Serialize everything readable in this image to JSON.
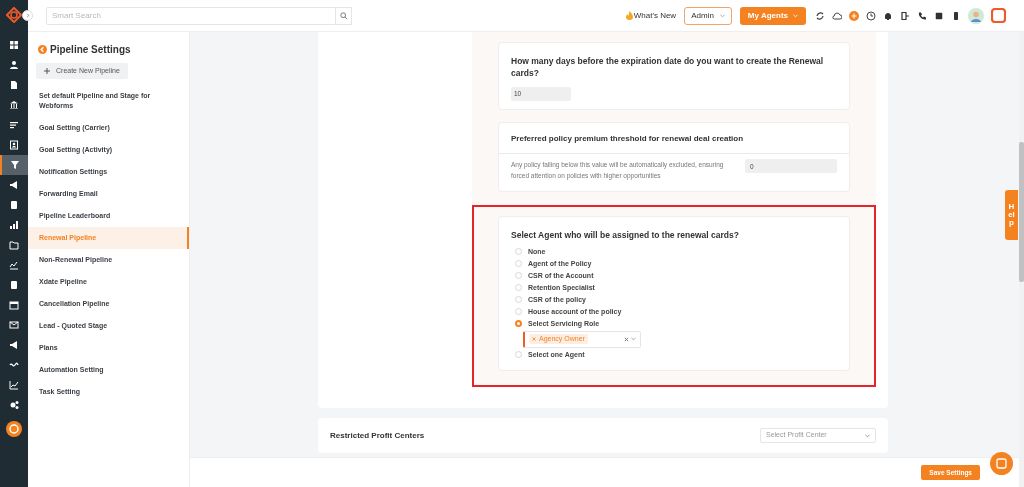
{
  "rail": [
    {
      "selected": false
    },
    {
      "selected": false
    },
    {
      "selected": false
    },
    {
      "selected": false
    },
    {
      "selected": false
    },
    {
      "selected": false
    },
    {
      "selected": true
    },
    {
      "selected": false
    },
    {
      "selected": false
    },
    {
      "selected": false
    },
    {
      "selected": false
    },
    {
      "selected": false
    },
    {
      "selected": false
    },
    {
      "selected": false
    },
    {
      "selected": false
    },
    {
      "selected": false
    },
    {
      "selected": false
    },
    {
      "selected": false
    },
    {
      "selected": false
    }
  ],
  "search": {
    "placeholder": "Smart Search"
  },
  "topbar": {
    "whats_new": "What's New",
    "role": "Admin",
    "agents_button": "My Agents"
  },
  "sidebar": {
    "title": "Pipeline Settings",
    "create_button": "Create New Pipeline",
    "items": [
      {
        "label": "Set default Pipeline and Stage for Webforms",
        "selected": false
      },
      {
        "label": "Goal Setting (Carrier)",
        "selected": false
      },
      {
        "label": "Goal Setting (Activity)",
        "selected": false
      },
      {
        "label": "Notification Settings",
        "selected": false
      },
      {
        "label": "Forwarding Email",
        "selected": false
      },
      {
        "label": "Pipeline Leaderboard",
        "selected": false
      },
      {
        "label": "Renewal Pipeline",
        "selected": true
      },
      {
        "label": "Non-Renewal Pipeline",
        "selected": false
      },
      {
        "label": "Xdate Pipeline",
        "selected": false
      },
      {
        "label": "Cancellation Pipeline",
        "selected": false
      },
      {
        "label": "Lead - Quoted Stage",
        "selected": false
      },
      {
        "label": "Plans",
        "selected": false
      },
      {
        "label": "Automation Setting",
        "selected": false
      },
      {
        "label": "Task Setting",
        "selected": false
      }
    ]
  },
  "days_card": {
    "question": "How many days before the expiration date do you want to create the Renewal cards?",
    "value": "10"
  },
  "threshold_card": {
    "title": "Preferred policy premium threshold for renewal deal creation",
    "description": "Any policy falling below this value will be automatically excluded, ensuring forced attention on policies with higher opportunities",
    "value": "0"
  },
  "agent_card": {
    "question": "Select Agent who will be assigned to the renewal cards?",
    "options": [
      {
        "label": "None",
        "selected": false
      },
      {
        "label": "Agent of the Policy",
        "selected": false
      },
      {
        "label": "CSR of the Account",
        "selected": false
      },
      {
        "label": "Retention Specialist",
        "selected": false
      },
      {
        "label": "CSR of the policy",
        "selected": false
      },
      {
        "label": "House account of the policy",
        "selected": false
      },
      {
        "label": "Select Servicing Role",
        "selected": true,
        "tags": [
          "Agency Owner"
        ]
      },
      {
        "label": "Select one Agent",
        "selected": false
      }
    ]
  },
  "profit_centers": {
    "title": "Restricted Profit Centers",
    "placeholder": "Select Profit Center"
  },
  "help_tab": "Help",
  "save_button": "Save Settings"
}
